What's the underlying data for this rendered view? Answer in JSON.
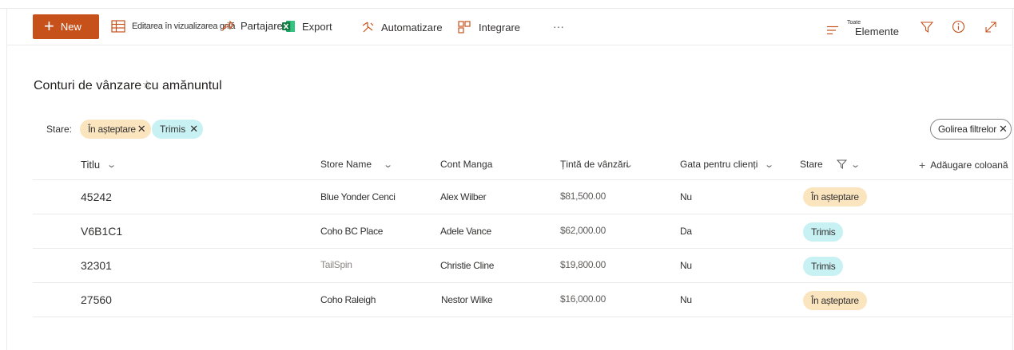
{
  "toolbar": {
    "new_label": "New",
    "edit_grid_label": "Editarea în vizualizarea grilă",
    "share_label": "Partajare",
    "export_label": "Export",
    "automate_label": "Automatizare",
    "integrate_label": "Integrare",
    "more_label": "···",
    "view_small_label": "Toate",
    "view_label": "Elemente"
  },
  "list": {
    "title": "Conturi de vânzare cu amănuntul"
  },
  "filters": {
    "label": "Stare:",
    "pills": [
      {
        "label": "În așteptare"
      },
      {
        "label": "Trimis"
      }
    ],
    "clear_label": "Golirea filtrelor"
  },
  "columns": {
    "title": "Titlu",
    "store_name": "Store Name",
    "cont_manga": "Cont Manga",
    "sales_target": "Țintă de vânzări",
    "ready": "Gata pentru clienți",
    "status": "Stare",
    "add_column": "Adăugare coloană"
  },
  "rows": [
    {
      "title": "45242",
      "store": "Blue Yonder Cenci",
      "account": "Alex Wilber",
      "target": "$81,500.00",
      "ready": "Nu",
      "status": "În așteptare"
    },
    {
      "title": "V6B1C1",
      "store": "Coho BC Place",
      "account": "Adele Vance",
      "target": "$62,000.00",
      "ready": "Da",
      "status": "Trimis"
    },
    {
      "title": "32301",
      "store": "TailSpin",
      "account": "Christie Cline",
      "target": "$19,800.00",
      "ready": "Nu",
      "status": "Trimis"
    },
    {
      "title": "27560",
      "store": "Coho Raleigh",
      "account": "Nestor Wilke",
      "target": "$16,000.00",
      "ready": "Nu",
      "status": "În așteptare"
    }
  ],
  "colors": {
    "accent": "#c7511b",
    "pending": "#fbe5bf",
    "sent": "#c8f1f4"
  }
}
